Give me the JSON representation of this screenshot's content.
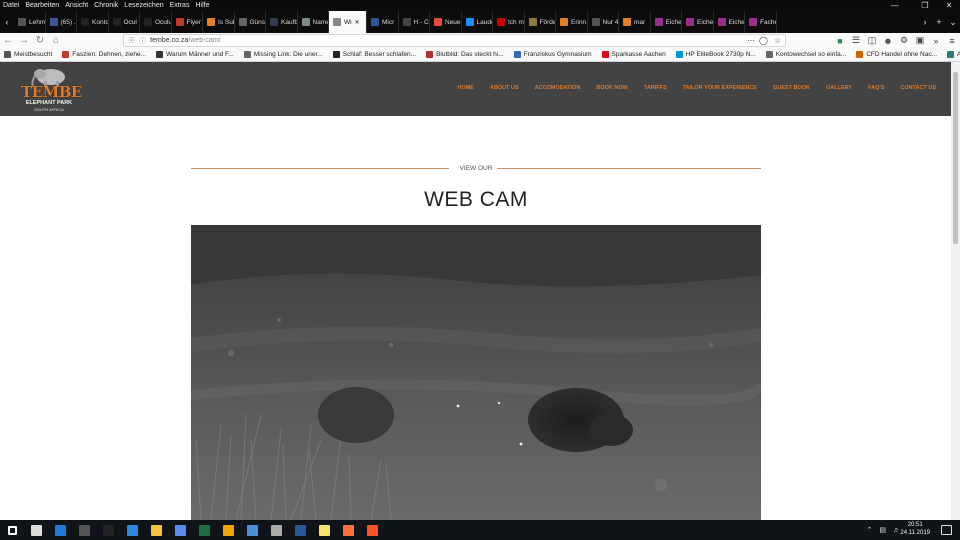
{
  "menubar": [
    "Datei",
    "Bearbeiten",
    "Ansicht",
    "Chronik",
    "Lesezeichen",
    "Extras",
    "Hilfe"
  ],
  "tabs": [
    {
      "label": "Lehm",
      "color": "#555555",
      "icon": "page-icon"
    },
    {
      "label": "(65) ...",
      "color": "#3b5998",
      "icon": "facebook-icon"
    },
    {
      "label": "Konto",
      "color": "#222222",
      "icon": "oculus-icon"
    },
    {
      "label": "Ocul",
      "color": "#222222",
      "icon": "oculus-icon"
    },
    {
      "label": "Oculu",
      "color": "#222222",
      "icon": "oculus-icon"
    },
    {
      "label": "Flyer",
      "color": "#c0392b",
      "icon": "flyer-icon"
    },
    {
      "label": "Is Sub",
      "color": "#e67e22",
      "icon": "rss-icon"
    },
    {
      "label": "Günst",
      "color": "#666666",
      "icon": "page-icon"
    },
    {
      "label": "Kaufb",
      "color": "#2c3e50",
      "icon": "table-icon"
    },
    {
      "label": "Name",
      "color": "#7f8c8d",
      "icon": "image-icon"
    },
    {
      "label": "Wi",
      "color": "#888888",
      "icon": "page-icon",
      "active": true
    },
    {
      "label": "Micr",
      "color": "#2b5797",
      "icon": "zoom-icon"
    },
    {
      "label": "H - CMS",
      "color": "#444444",
      "icon": "page-icon"
    },
    {
      "label": "Neue",
      "color": "#e74c3c",
      "icon": "firefox-icon"
    },
    {
      "label": "Laude",
      "color": "#1e90ff",
      "icon": "circle-icon"
    },
    {
      "label": "Ich m",
      "color": "#cc0000",
      "icon": "youtube-icon"
    },
    {
      "label": "Förde",
      "color": "#8e7a3a",
      "icon": "page-icon"
    },
    {
      "label": "Erinn",
      "color": "#e67e22",
      "icon": "rss-icon"
    },
    {
      "label": "Nur 49 EU",
      "color": "#555555",
      "icon": "page-icon"
    },
    {
      "label": "mar",
      "color": "#e67e22",
      "icon": "rss-icon"
    },
    {
      "label": "Eiche",
      "color": "#9b2d8e",
      "icon": "eiche-icon"
    },
    {
      "label": "Eiche",
      "color": "#9b2d8e",
      "icon": "eiche-icon"
    },
    {
      "label": "Eiche",
      "color": "#9b2d8e",
      "icon": "eiche-icon"
    },
    {
      "label": "Fache",
      "color": "#9b2d8e",
      "icon": "eiche-icon"
    }
  ],
  "url": {
    "domain": "tembe.co.za",
    "path": "/web-cam/"
  },
  "bookmarks": [
    {
      "label": "Meistbesucht",
      "color": "#555555"
    },
    {
      "label": "Faszien: Dehnen, ziehe...",
      "color": "#c0392b"
    },
    {
      "label": "Warum Männer und F...",
      "color": "#333333"
    },
    {
      "label": "Missing Link: Die uner...",
      "color": "#666666"
    },
    {
      "label": "Schlaf: Besser schlafen...",
      "color": "#222222"
    },
    {
      "label": "Blutbild: Das steckt hi...",
      "color": "#b03030"
    },
    {
      "label": "Franziskus Gymnasium",
      "color": "#2d6db5"
    },
    {
      "label": "Sparkasse Aachen",
      "color": "#e2001a"
    },
    {
      "label": "HP EliteBook 2730p N...",
      "color": "#0096d6"
    },
    {
      "label": "Kontowechsel so einfa...",
      "color": "#666666"
    },
    {
      "label": "CFD Handel ohne Nac...",
      "color": "#cc6600"
    },
    {
      "label": "Aktienanleihe des Mo...",
      "color": "#2b7a78"
    }
  ],
  "site": {
    "logo_main": "TEMBE",
    "logo_sub": "ELEPHANT PARK",
    "logo_sub2": "SOUTH AFRICA",
    "nav": [
      "HOME",
      "ABOUT US",
      "ACCOMODATION",
      "BOOK NOW",
      "TARIFFS",
      "TAILOR YOUR EXPERIENCE",
      "GUEST BOOK",
      "GALLERY",
      "FAQ'S",
      "CONTACT US"
    ],
    "kicker": "VIEW OUR",
    "title": "WEB CAM",
    "accent": "#d97a2b",
    "header_bg": "#434343"
  },
  "taskbar": {
    "apps": [
      {
        "name": "start-icon",
        "color": "#ffffff"
      },
      {
        "name": "task-view-icon",
        "color": "#dddddd"
      },
      {
        "name": "edge-icon",
        "color": "#1e7bd6"
      },
      {
        "name": "calculator-icon",
        "color": "#555555"
      },
      {
        "name": "terminal-icon",
        "color": "#222222"
      },
      {
        "name": "vm-icon",
        "color": "#2e86de"
      },
      {
        "name": "explorer-icon",
        "color": "#f5c542"
      },
      {
        "name": "network-icon",
        "color": "#5a8dee"
      },
      {
        "name": "excel-icon",
        "color": "#1d6f42"
      },
      {
        "name": "folder-icon",
        "color": "#f0a500"
      },
      {
        "name": "remote-icon",
        "color": "#4a90d9"
      },
      {
        "name": "paint-icon",
        "color": "#aaaaaa"
      },
      {
        "name": "word-icon",
        "color": "#2b579a"
      },
      {
        "name": "sticky-notes-icon",
        "color": "#f7e26b"
      },
      {
        "name": "firefox-icon",
        "color": "#ff7139"
      },
      {
        "name": "brave-icon",
        "color": "#fb542b"
      }
    ],
    "time": "20:51",
    "date": "24.11.2019"
  }
}
